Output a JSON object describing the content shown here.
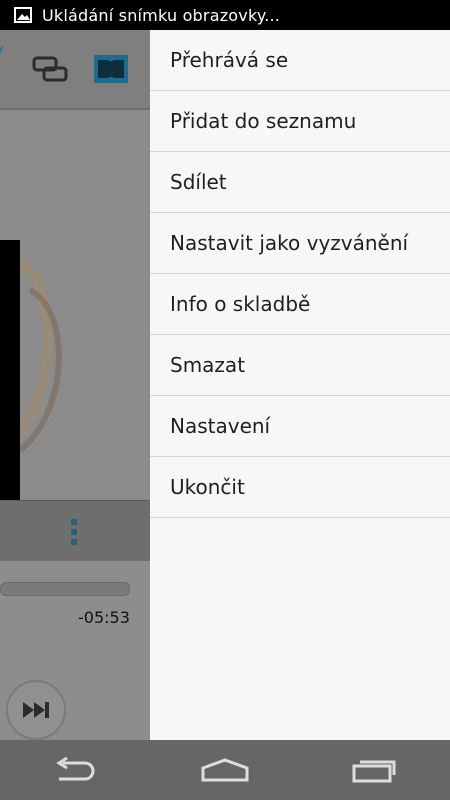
{
  "status_bar": {
    "notification_icon": "image-icon",
    "notification_text": "Ukládání snímku obrazovky..."
  },
  "player": {
    "top_icons": [
      "repeat-icon",
      "dolby-icon"
    ],
    "time_remaining": "-05:53",
    "next_button_icon": "next-track-icon"
  },
  "menu": {
    "items": [
      {
        "label": "Přehrává se"
      },
      {
        "label": "Přidat do seznamu"
      },
      {
        "label": "Sdílet"
      },
      {
        "label": "Nastavit jako vyzvánění"
      },
      {
        "label": "Info o skladbě"
      },
      {
        "label": "Smazat"
      },
      {
        "label": "Nastavení"
      },
      {
        "label": "Ukončit"
      }
    ]
  },
  "nav_bar": {
    "buttons": [
      "back-icon",
      "home-icon",
      "recent-apps-icon"
    ]
  },
  "colors": {
    "menu_background": "#f7f7f7",
    "divider": "#d6d6d6",
    "nav_bar": "#666666",
    "accent": "#2a6f9a"
  }
}
